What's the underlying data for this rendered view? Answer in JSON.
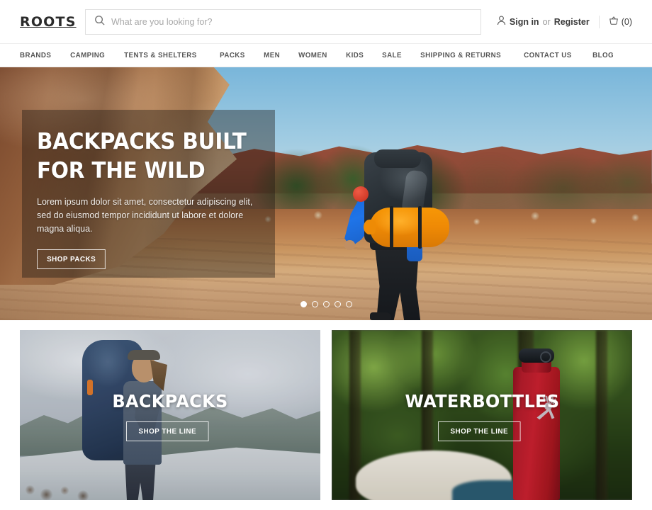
{
  "header": {
    "logo": "ROOTS",
    "search": {
      "placeholder": "What are you looking for?",
      "value": "",
      "icon": "search-icon"
    },
    "account": {
      "icon": "user-icon",
      "sign_in": "Sign in",
      "or": "or",
      "register": "Register"
    },
    "cart": {
      "icon": "basket-icon",
      "count_label": "(0)"
    }
  },
  "nav": {
    "items": [
      {
        "label": "BRANDS"
      },
      {
        "label": "CAMPING"
      },
      {
        "label": "TENTS & SHELTERS"
      },
      {
        "label": "PACKS"
      },
      {
        "label": "MEN"
      },
      {
        "label": "WOMEN"
      },
      {
        "label": "KIDS"
      },
      {
        "label": "SALE"
      },
      {
        "label": "SHIPPING & RETURNS"
      },
      {
        "label": "CONTACT US"
      },
      {
        "label": "BLOG"
      }
    ]
  },
  "hero": {
    "title": "BACKPACKS BUILT\nFOR THE WILD",
    "body": "Lorem ipsum dolor sit amet, consectetur adipiscing elit, sed do eiusmod tempor incididunt ut labore et dolore magna aliqua.",
    "cta": "SHOP PACKS",
    "carousel": {
      "slide_count": 5,
      "active_index": 0
    }
  },
  "promos": [
    {
      "title": "BACKPACKS",
      "cta": "SHOP THE LINE"
    },
    {
      "title": "WATERBOTTLES",
      "cta": "SHOP THE LINE"
    }
  ],
  "colors": {
    "text_dark": "#2b2b2b",
    "nav_text": "#555555",
    "muted": "#9a9a9a",
    "border": "#e0e0e0",
    "white": "#ffffff"
  }
}
